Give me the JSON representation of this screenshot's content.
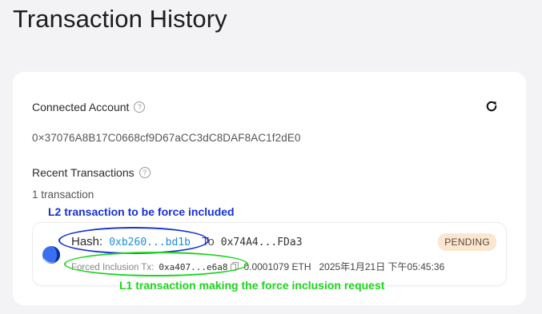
{
  "page": {
    "title": "Transaction History"
  },
  "account": {
    "label": "Connected Account",
    "address": "0×37076A8B17C0668cf9D67aCC3dC8DAF8AC1f2dE0"
  },
  "recent": {
    "label": "Recent Transactions",
    "count_text": "1 transaction"
  },
  "icons": {
    "help": "?"
  },
  "annotations": {
    "l2": "L2 transaction to be force included",
    "l1": "L1 transaction making the force inclusion request",
    "l2_color": "#1531d4",
    "l1_color": "#1fd41f"
  },
  "transaction": {
    "hash_label": "Hash:",
    "hash": "0xb260...bd1b",
    "to_label": "To",
    "to": "0x74A4...FDa3",
    "status": "PENDING",
    "forced_label": "Forced Inclusion Tx:",
    "forced_hash": "0xa407...e6a8",
    "amount": "0.0001079 ETH",
    "time": "2025年1月21日 下午05:45:36"
  },
  "colors": {
    "link": "#1f8fd6",
    "badge_bg": "#fbe6d0"
  }
}
